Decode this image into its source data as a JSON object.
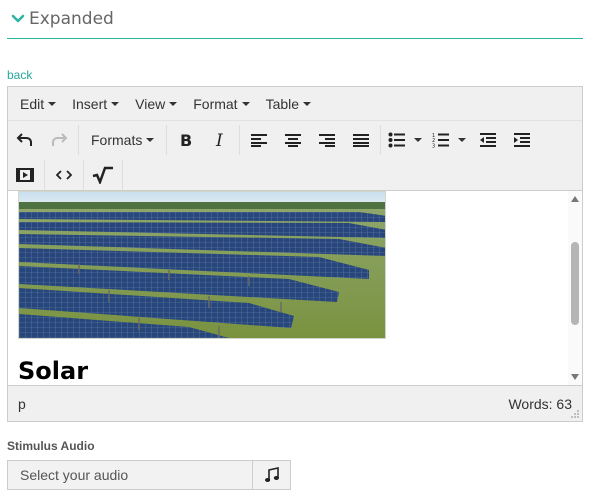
{
  "section": {
    "title": "Expanded",
    "accent_color": "#2bb3a3",
    "icon": "chevron-down-icon"
  },
  "back_link": "back",
  "editor": {
    "menu": [
      {
        "label": "Edit"
      },
      {
        "label": "Insert"
      },
      {
        "label": "View"
      },
      {
        "label": "Format"
      },
      {
        "label": "Table"
      }
    ],
    "toolbar": {
      "formats_label": "Formats",
      "icons": [
        "undo-icon",
        "redo-icon",
        "bold-icon",
        "italic-icon",
        "align-left-icon",
        "align-center-icon",
        "align-right-icon",
        "justify-icon",
        "bullet-list-icon",
        "numbered-list-icon",
        "outdent-icon",
        "indent-icon",
        "media-icon",
        "code-icon",
        "equation-icon"
      ]
    },
    "content": {
      "image_alt": "solar panel field",
      "heading": "Solar"
    },
    "status": {
      "path": "p",
      "word_count": "Words: 63"
    }
  },
  "stimulus_audio": {
    "label": "Stimulus Audio",
    "placeholder": "Select your audio",
    "icon": "music-note-icon"
  }
}
